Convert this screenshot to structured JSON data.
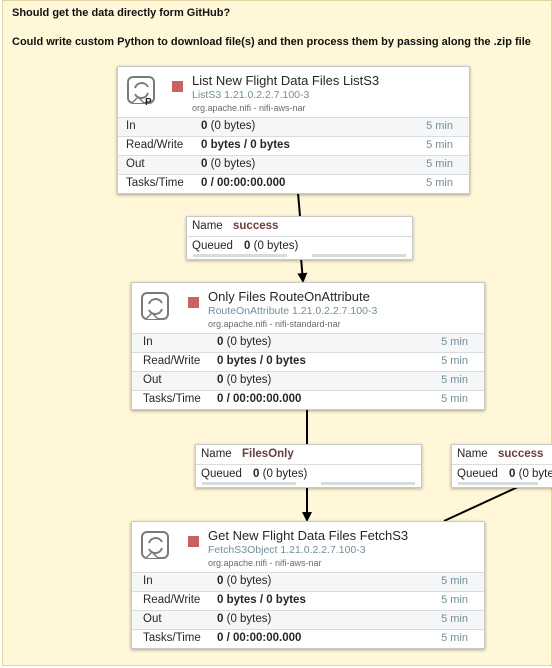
{
  "label": {
    "line1": "Should get the data directly form GitHub?",
    "line2": "Could write custom Python to download file(s) and then process them by passing along the .zip file"
  },
  "processors": [
    {
      "name": "List New Flight Data Files ListS3",
      "type": "ListS3 1.21.0.2.2.7.100-3",
      "bundle": "org.apache.nifi - nifi-aws-nar",
      "primary_badge": "P",
      "state_color": "#c86161",
      "stats": [
        {
          "name": "In",
          "count": "0",
          "size": "(0 bytes)",
          "time": "5 min"
        },
        {
          "name": "Read/Write",
          "count": "0 bytes / 0 bytes",
          "size": "",
          "time": "5 min"
        },
        {
          "name": "Out",
          "count": "0",
          "size": "(0 bytes)",
          "time": "5 min"
        },
        {
          "name": "Tasks/Time",
          "count": "0 / 00:00:00.000",
          "size": "",
          "time": "5 min"
        }
      ]
    },
    {
      "name": "Only Files RouteOnAttribute",
      "type": "RouteOnAttribute 1.21.0.2.2.7.100-3",
      "bundle": "org.apache.nifi - nifi-standard-nar",
      "state_color": "#c86161",
      "stats": [
        {
          "name": "In",
          "count": "0",
          "size": "(0 bytes)",
          "time": "5 min"
        },
        {
          "name": "Read/Write",
          "count": "0 bytes / 0 bytes",
          "size": "",
          "time": "5 min"
        },
        {
          "name": "Out",
          "count": "0",
          "size": "(0 bytes)",
          "time": "5 min"
        },
        {
          "name": "Tasks/Time",
          "count": "0 / 00:00:00.000",
          "size": "",
          "time": "5 min"
        }
      ]
    },
    {
      "name": "Get New Flight Data Files FetchS3",
      "type": "FetchS3Object 1.21.0.2.2.7.100-3",
      "bundle": "org.apache.nifi - nifi-aws-nar",
      "state_color": "#c86161",
      "stats": [
        {
          "name": "In",
          "count": "0",
          "size": "(0 bytes)",
          "time": "5 min"
        },
        {
          "name": "Read/Write",
          "count": "0 bytes / 0 bytes",
          "size": "",
          "time": "5 min"
        },
        {
          "name": "Out",
          "count": "0",
          "size": "(0 bytes)",
          "time": "5 min"
        },
        {
          "name": "Tasks/Time",
          "count": "0 / 00:00:00.000",
          "size": "",
          "time": "5 min"
        }
      ]
    }
  ],
  "connections": [
    {
      "name_key": "Name",
      "name": "success",
      "queued_key": "Queued",
      "queued_count": "0",
      "queued_size": "(0 bytes)"
    },
    {
      "name_key": "Name",
      "name": "FilesOnly",
      "queued_key": "Queued",
      "queued_count": "0",
      "queued_size": "(0 bytes)"
    },
    {
      "name_key": "Name",
      "name": "success",
      "queued_key": "Queued",
      "queued_count": "0",
      "queued_size": "(0 byte"
    }
  ],
  "colors": {
    "label_background": "#fff7d7",
    "stopped_state": "#c86161",
    "type_text": "#728e9b",
    "connection_name": "#6b3d3d"
  },
  "icons": {
    "processor": "processor-icon",
    "stopped": "stop-icon"
  }
}
